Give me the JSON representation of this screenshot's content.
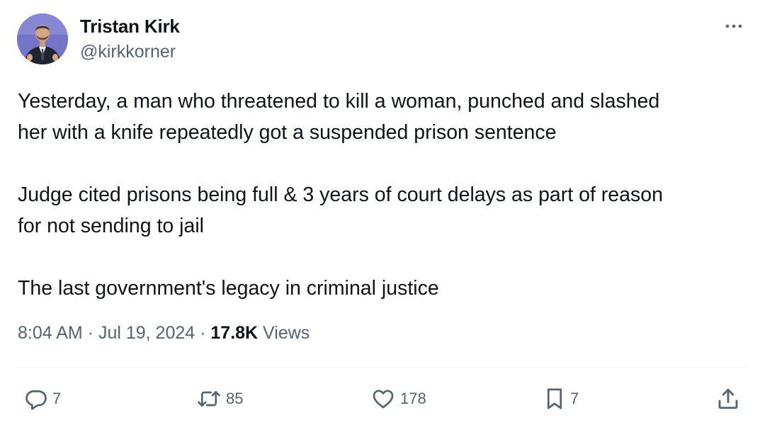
{
  "author": {
    "name": "Tristan Kirk",
    "handle": "@kirkkorner"
  },
  "icons": {
    "more": "more-horizontal-icon",
    "reply": "reply-icon",
    "retweet": "retweet-icon",
    "like": "heart-icon",
    "bookmark": "bookmark-icon",
    "share": "share-icon"
  },
  "tweet": {
    "paragraph1_line1": "Yesterday, a man who threatened to kill a woman, punched and slashed",
    "paragraph1_line2": "her with a knife repeatedly got a suspended prison sentence",
    "paragraph2_line1": "Judge cited prisons being full & 3 years of court delays as part of reason",
    "paragraph2_line2": "for not sending to jail",
    "paragraph3_line1": "The last government's legacy in criminal justice"
  },
  "meta": {
    "time": "8:04 AM",
    "separator": " · ",
    "date": "Jul 19, 2024",
    "views_count": "17.8K",
    "views_label": " Views"
  },
  "actions": {
    "replies": "7",
    "retweets": "85",
    "likes": "178",
    "bookmarks": "7"
  },
  "colors": {
    "text_primary": "#0f1419",
    "text_secondary": "#536471",
    "divider": "#eff3f4",
    "avatar_bg": "#6f6fc7"
  }
}
